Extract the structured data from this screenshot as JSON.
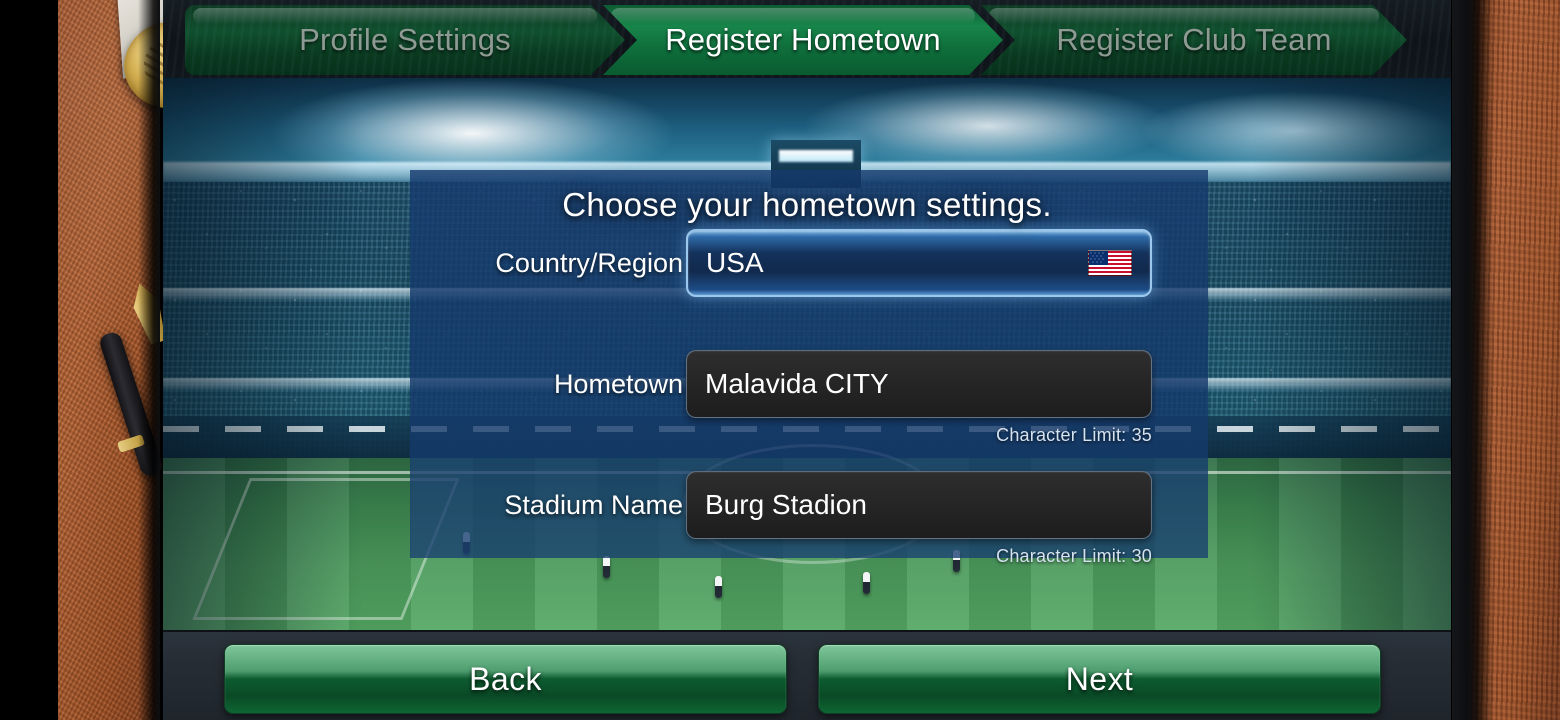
{
  "tabs": [
    {
      "label": "Profile Settings",
      "active": false
    },
    {
      "label": "Register Hometown",
      "active": true
    },
    {
      "label": "Register Club Team",
      "active": false
    }
  ],
  "heading": "Choose your hometown settings.",
  "form": {
    "country": {
      "label": "Country/Region",
      "value": "USA",
      "flag_icon": "usa-flag-icon"
    },
    "hometown": {
      "label": "Hometown",
      "value": "Malavida CITY",
      "placeholder": "Malavida CITY",
      "limit_text": "Character Limit: 35"
    },
    "stadium": {
      "label": "Stadium Name",
      "value": "Burg Stadion",
      "placeholder": "Burg Stadion",
      "limit_text": "Character Limit: 30"
    }
  },
  "footer": {
    "back_label": "Back",
    "next_label": "Next"
  },
  "colors": {
    "tab_active_green": "#17854a",
    "tab_inactive_green": "#10502e",
    "panel_blue": "#163a6e",
    "select_highlight": "#9cc8ee",
    "button_green": "#0d5c30",
    "pitch_green": "#4b9a5c",
    "bottom_bar": "#252c34"
  }
}
